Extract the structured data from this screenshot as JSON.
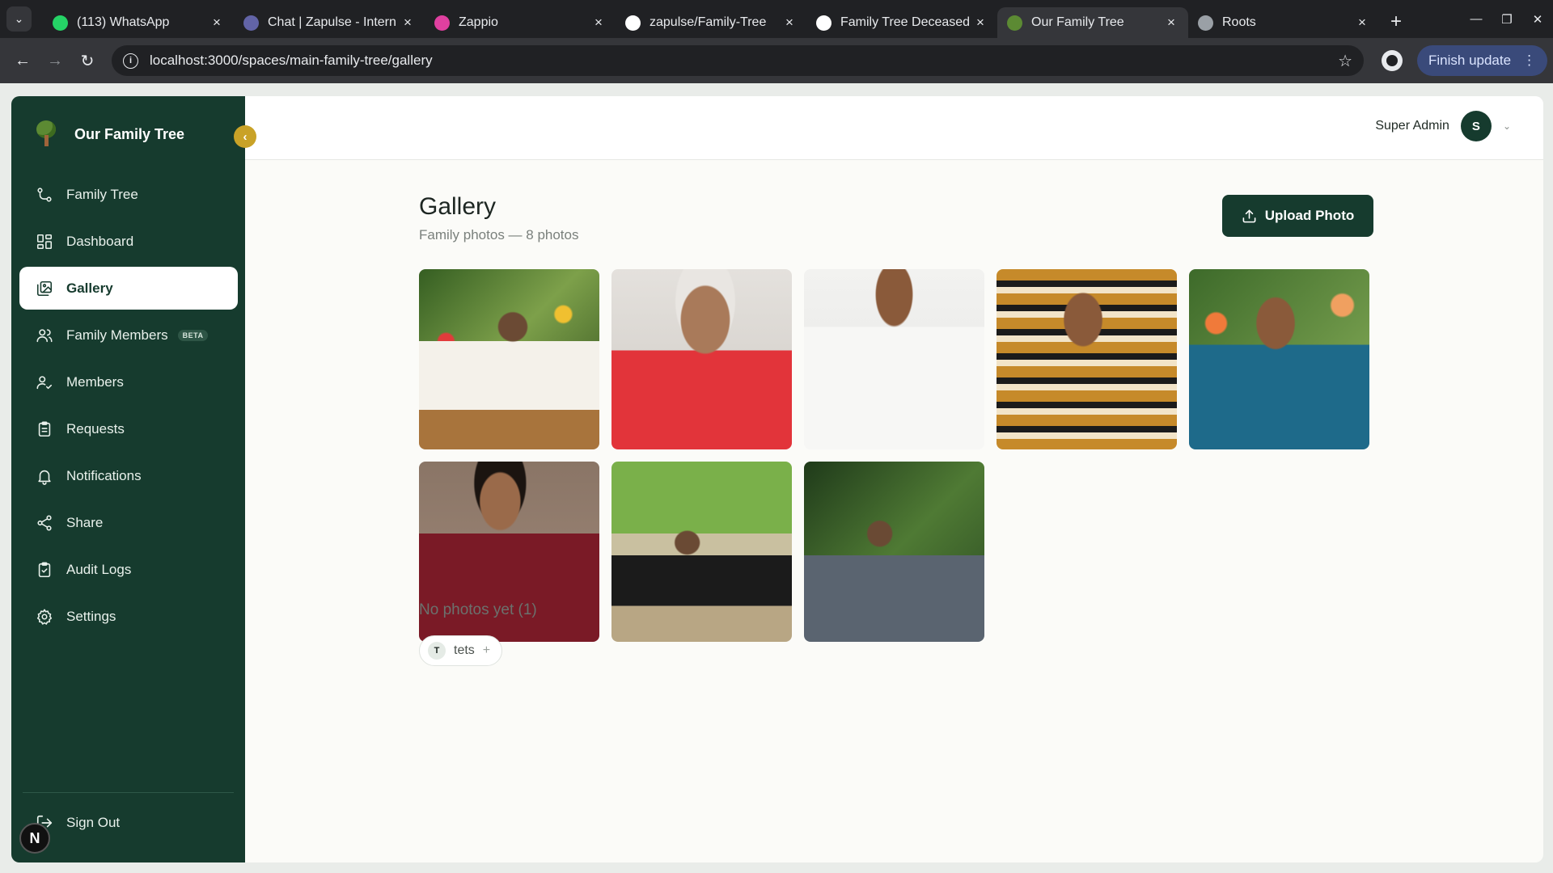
{
  "browser": {
    "tabs": [
      {
        "title": "(113) WhatsApp",
        "icon": "whatsapp-icon",
        "color": "#25d366"
      },
      {
        "title": "Chat | Zapulse - Intern",
        "icon": "teams-icon",
        "color": "#6264a7"
      },
      {
        "title": "Zappio",
        "icon": "zappio-icon",
        "color": "#e040a0"
      },
      {
        "title": "zapulse/Family-Tree",
        "icon": "github-icon",
        "color": "#ffffff"
      },
      {
        "title": "Family Tree Deceased",
        "icon": "openai-icon",
        "color": "#ffffff"
      },
      {
        "title": "Our Family Tree",
        "icon": "tree-icon",
        "color": "#5c8a33",
        "active": true
      },
      {
        "title": "Roots",
        "icon": "globe-icon",
        "color": "#9aa0a6"
      }
    ],
    "url": "localhost:3000/spaces/main-family-tree/gallery",
    "finish_update": "Finish update"
  },
  "sidebar": {
    "brand": "Our Family Tree",
    "items": [
      {
        "label": "Family Tree",
        "icon": "tree-branch-icon"
      },
      {
        "label": "Dashboard",
        "icon": "dashboard-icon"
      },
      {
        "label": "Gallery",
        "icon": "gallery-icon",
        "active": true
      },
      {
        "label": "Family Members",
        "icon": "users-icon",
        "badge": "BETA"
      },
      {
        "label": "Members",
        "icon": "user-check-icon"
      },
      {
        "label": "Requests",
        "icon": "clipboard-icon"
      },
      {
        "label": "Notifications",
        "icon": "bell-icon"
      },
      {
        "label": "Share",
        "icon": "share-icon"
      },
      {
        "label": "Audit Logs",
        "icon": "clipboard-check-icon"
      },
      {
        "label": "Settings",
        "icon": "gear-icon"
      }
    ],
    "sign_out": "Sign Out"
  },
  "header": {
    "user_name": "Super Admin",
    "avatar_initial": "S"
  },
  "gallery": {
    "title": "Gallery",
    "subtitle": "Family photos — 8 photos",
    "upload_label": "Upload Photo",
    "photos": [
      {
        "desc": "man in white seated in wicker chair among flowers"
      },
      {
        "desc": "elderly woman in red saree smiling"
      },
      {
        "desc": "man in white shirt with crossed arms"
      },
      {
        "desc": "man in striped t-shirt by tree"
      },
      {
        "desc": "woman in blue saree in garden"
      },
      {
        "desc": "woman in maroon silk saree"
      },
      {
        "desc": "young man leaning on railing under trees"
      },
      {
        "desc": "young man in checked shirt among greenery"
      }
    ],
    "no_photos_heading": "No photos yet (1)",
    "no_photos_members": [
      {
        "initial": "T",
        "name": "tets"
      }
    ]
  },
  "colors": {
    "sidebar_bg": "#163b2e",
    "accent": "#c9a227",
    "primary_button": "#163b2e"
  }
}
